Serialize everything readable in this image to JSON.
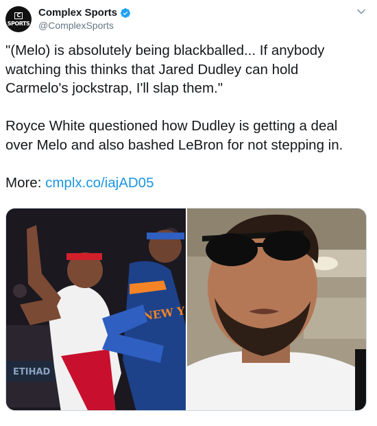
{
  "account": {
    "display_name": "Complex Sports",
    "handle": "@ComplexSports",
    "avatar_mark": "C",
    "avatar_text": "SPORTS",
    "verified": true
  },
  "tweet": {
    "paragraph_1": "\"(Melo) is absolutely being blackballed... If anybody watching this thinks that Jared Dudley can hold Carmelo's jockstrap, I'll slap them.\"",
    "paragraph_2": "Royce White questioned how Dudley is getting a deal over Melo and also bashed LeBron for not stepping in.",
    "more_label": "More:",
    "link_text": "cmplx.co/iajAD05"
  },
  "media": {
    "left_image": {
      "jersey_text": "NEW Y",
      "banner_text": "ETIHAD"
    },
    "right_image": {}
  },
  "colors": {
    "link": "#1b95e0",
    "verified": "#1da1f2",
    "secondary_text": "#657786"
  },
  "icons": {
    "verified": "verified-badge-icon",
    "menu": "chevron-down-icon"
  }
}
